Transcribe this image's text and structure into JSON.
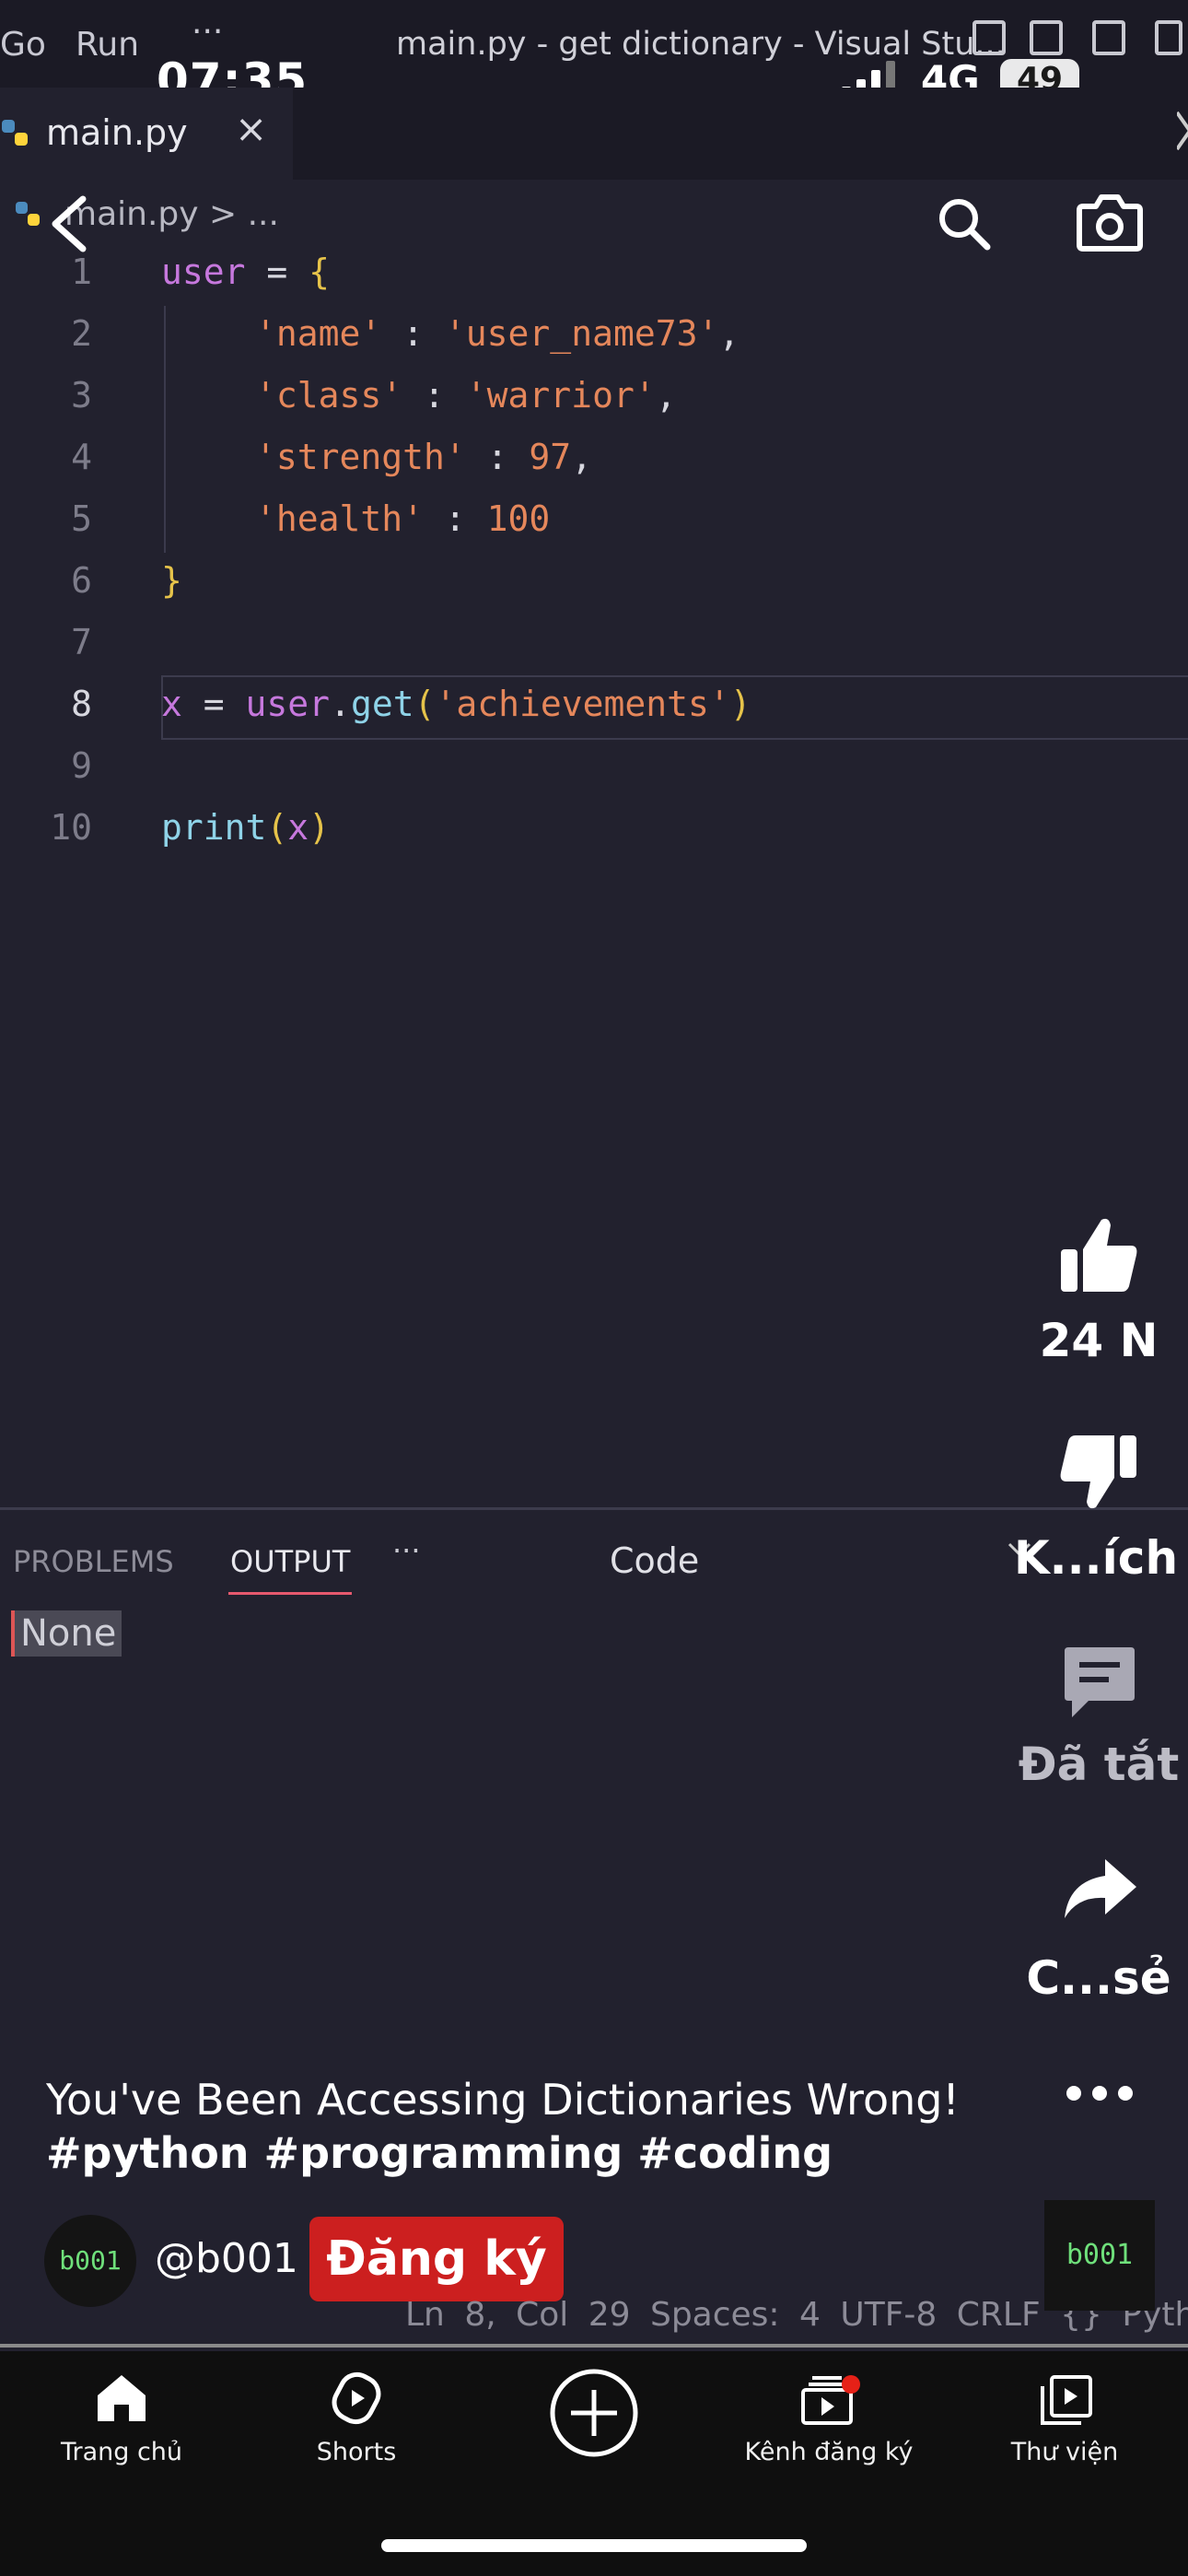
{
  "vscode": {
    "menu": [
      "Go",
      "Run",
      "···"
    ],
    "window_title": "main.py - get dictionary - Visual Stu...",
    "tab": {
      "label": "main.py",
      "close": "×"
    },
    "breadcrumb": "main.py > ...",
    "lines": [
      {
        "n": "1"
      },
      {
        "n": "2"
      },
      {
        "n": "3"
      },
      {
        "n": "4"
      },
      {
        "n": "5"
      },
      {
        "n": "6"
      },
      {
        "n": "7"
      },
      {
        "n": "8"
      },
      {
        "n": "9"
      },
      {
        "n": "10"
      }
    ],
    "code": {
      "l1_var": "user",
      "l1_op": " = ",
      "l1_brace": "{",
      "l2_key": "'name'",
      "l2_sep": " : ",
      "l2_val": "'user_name73'",
      "l2_end": ",",
      "l3_key": "'class'",
      "l3_sep": " : ",
      "l3_val": "'warrior'",
      "l3_end": ",",
      "l4_key": "'strength'",
      "l4_sep": " : ",
      "l4_val": "97",
      "l4_end": ",",
      "l5_key": "'health'",
      "l5_sep": " : ",
      "l5_val": "100",
      "l6_brace": "}",
      "l8_var": "x",
      "l8_op": " = ",
      "l8_obj": "user",
      "l8_dot": ".",
      "l8_fn": "get",
      "l8_open": "(",
      "l8_arg": "'achievements'",
      "l8_close": ")",
      "l10_fn": "print",
      "l10_open": "(",
      "l10_arg": "x",
      "l10_close": ")"
    },
    "panel": {
      "tabs": [
        "PROBLEMS",
        "OUTPUT",
        "···"
      ],
      "output_source": "Code",
      "output": "None"
    },
    "statusbar": "Ln 8, Col 29   Spaces: 4   UTF-8   CRLF   {} Pyth"
  },
  "phone": {
    "time": "07:35",
    "network": "4G",
    "battery": "49"
  },
  "shorts": {
    "likes": "24 N",
    "dislike_label": "K...ích",
    "comments_label": "Đã tắt",
    "share_label": "C...sẻ",
    "title": "You've Been Accessing Dictionaries Wrong!",
    "hashtags": "#python #programming #coding",
    "channel": {
      "avatar_text": "b001",
      "handle": "@b001"
    },
    "subscribe": "Đăng ký",
    "thumb_text": "b001"
  },
  "nav": {
    "items": [
      {
        "label": "Trang chủ"
      },
      {
        "label": "Shorts"
      },
      {
        "label": ""
      },
      {
        "label": "Kênh đăng ký"
      },
      {
        "label": "Thư viện"
      }
    ]
  },
  "colors": {
    "accent": "#cc1f1f",
    "editor_bg": "#22212e",
    "keyword": "#c678dd",
    "string": "#e5875b"
  }
}
